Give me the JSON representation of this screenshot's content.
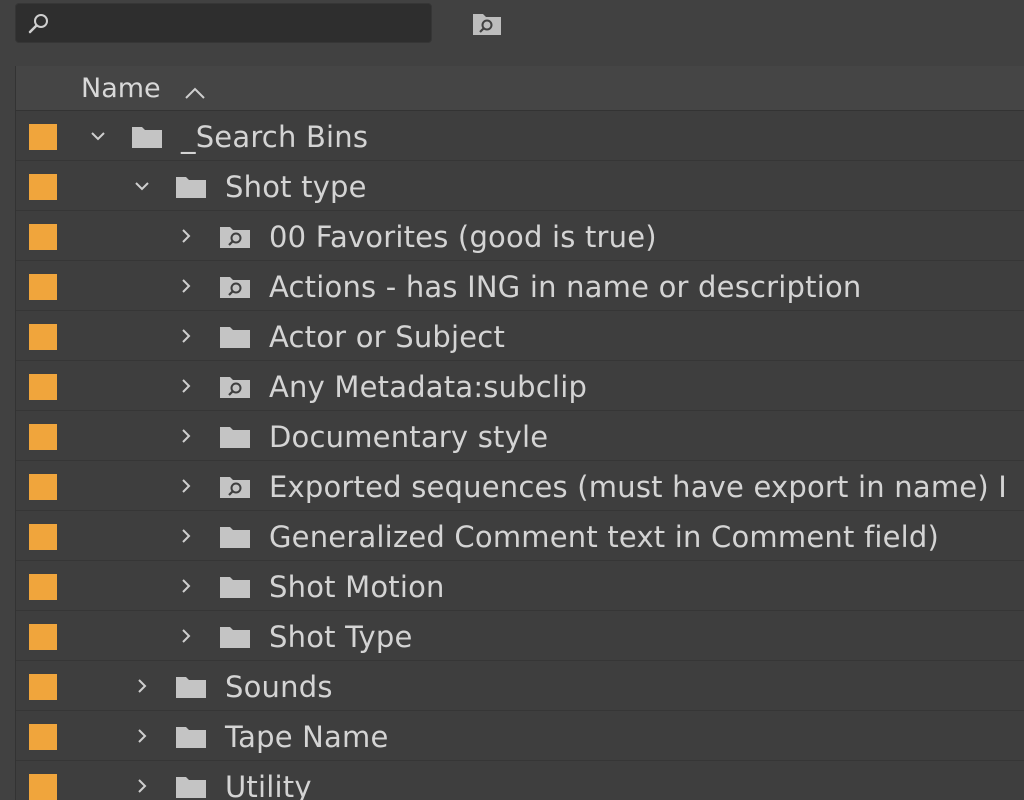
{
  "search": {
    "value": "",
    "placeholder": ""
  },
  "header": {
    "name_column": "Name"
  },
  "label_color": "#f0a53c",
  "rows": [
    {
      "name": "_Search Bins",
      "type": "folder",
      "expanded": true
    },
    {
      "name": "Shot type",
      "type": "folder",
      "expanded": true
    },
    {
      "name": "00 Favorites (good is true)",
      "type": "search-bin",
      "expanded": false
    },
    {
      "name": "Actions - has ING in name or description",
      "type": "search-bin",
      "expanded": false
    },
    {
      "name": "Actor or Subject",
      "type": "folder",
      "expanded": false
    },
    {
      "name": "Any Metadata:subclip",
      "type": "search-bin",
      "expanded": false
    },
    {
      "name": "Documentary style",
      "type": "folder",
      "expanded": false
    },
    {
      "name": "Exported sequences (must have export in name) I",
      "type": "search-bin",
      "expanded": false
    },
    {
      "name": "Generalized Comment text in Comment field)",
      "type": "folder",
      "expanded": false
    },
    {
      "name": "Shot Motion",
      "type": "folder",
      "expanded": false
    },
    {
      "name": "Shot Type",
      "type": "folder",
      "expanded": false
    },
    {
      "name": "Sounds",
      "type": "folder",
      "expanded": false
    },
    {
      "name": "Tape Name",
      "type": "folder",
      "expanded": false
    },
    {
      "name": "Utility",
      "type": "folder",
      "expanded": false
    }
  ]
}
